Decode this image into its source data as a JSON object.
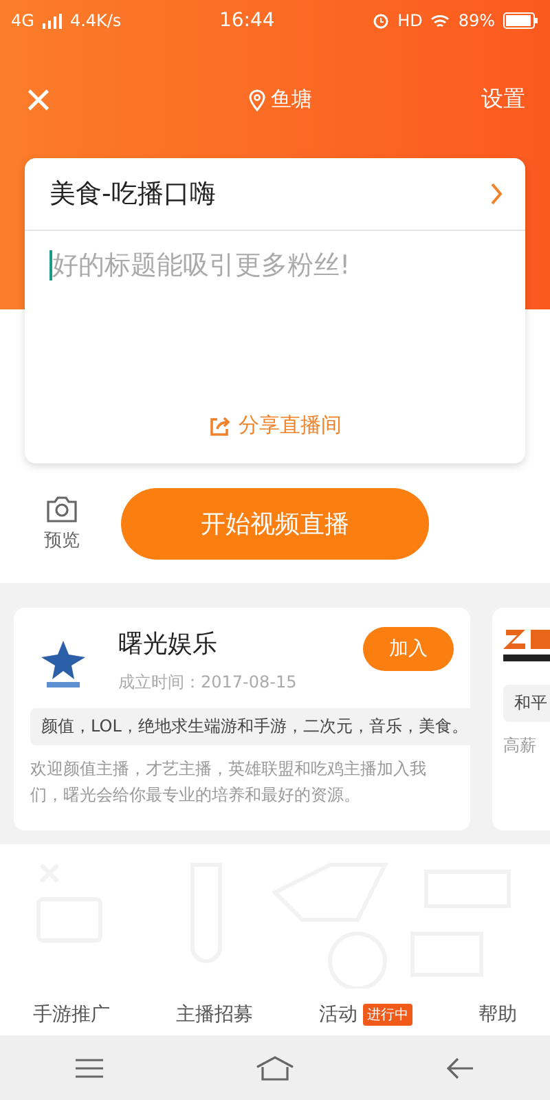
{
  "status_bar": {
    "network": "4G",
    "speed": "4.4K/s",
    "time": "16:44",
    "hd": "HD",
    "battery": "89%"
  },
  "header": {
    "close": "×",
    "location": "鱼塘",
    "settings": "设置"
  },
  "stream_card": {
    "category": "美食-吃播口嗨",
    "title_placeholder": "好的标题能吸引更多粉丝!",
    "share": "分享直播间"
  },
  "preview": {
    "label": "预览"
  },
  "start_button": "开始视频直播",
  "guilds": [
    {
      "name": "曙光娱乐",
      "founded": "成立时间：2017-08-15",
      "join": "加入",
      "tags": "颜值，LOL，绝地求生端游和手游，二次元，音乐，美食。",
      "description": "欢迎颜值主播，才艺主播，英雄联盟和吃鸡主播加入我们，曙光会给你最专业的培养和最好的资源。"
    },
    {
      "tags": "和平",
      "description": "高薪"
    }
  ],
  "menu": [
    {
      "label": "手游推广"
    },
    {
      "label": "主播招募"
    },
    {
      "label": "活动",
      "badge": "进行中"
    },
    {
      "label": "帮助"
    }
  ]
}
